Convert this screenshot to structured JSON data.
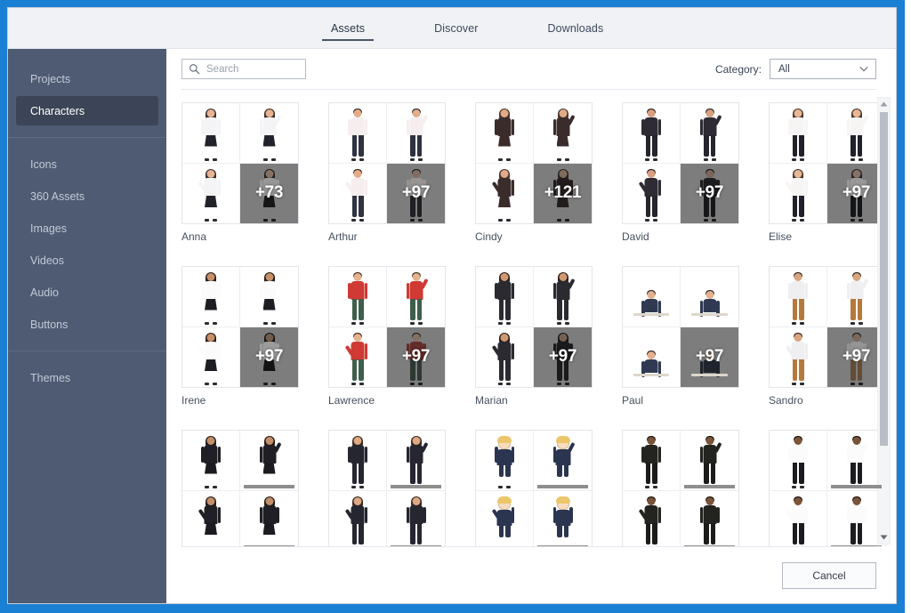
{
  "window": {
    "frame_color": "#1a80d4",
    "sidebar_color": "#4e5b73",
    "header_color": "#f0f2f5"
  },
  "tabs": [
    {
      "label": "Assets",
      "active": true
    },
    {
      "label": "Discover",
      "active": false
    },
    {
      "label": "Downloads",
      "active": false
    }
  ],
  "sidebar": {
    "groups": [
      {
        "items": [
          {
            "label": "Projects",
            "active": false
          },
          {
            "label": "Characters",
            "active": true
          }
        ]
      },
      {
        "items": [
          {
            "label": "Icons",
            "active": false
          },
          {
            "label": "360 Assets",
            "active": false
          },
          {
            "label": "Images",
            "active": false
          },
          {
            "label": "Videos",
            "active": false
          },
          {
            "label": "Audio",
            "active": false
          },
          {
            "label": "Buttons",
            "active": false
          }
        ]
      },
      {
        "items": [
          {
            "label": "Themes",
            "active": false
          }
        ]
      }
    ]
  },
  "toolbar": {
    "search": {
      "placeholder": "Search",
      "value": ""
    },
    "category": {
      "label": "Category:",
      "selected": "All",
      "options": [
        "All"
      ]
    }
  },
  "grid": {
    "cards": [
      {
        "name": "Anna",
        "more": "+73",
        "kind": "woman-skirt",
        "hair": "#3a2e28",
        "top": "#f4f4f6",
        "bottom": "#22232a",
        "skin": "#e6b493"
      },
      {
        "name": "Arthur",
        "more": "+97",
        "kind": "man-suit",
        "hair": "#2b2521",
        "top": "#f6eeee",
        "bottom": "#2f3340",
        "skin": "#e2ac89"
      },
      {
        "name": "Cindy",
        "more": "+121",
        "kind": "woman-dress",
        "hair": "#4a332a",
        "top": "#3b2c2c",
        "bottom": "#3b2c2c",
        "skin": "#e0ab88"
      },
      {
        "name": "David",
        "more": "+97",
        "kind": "man-dark",
        "hair": "#241f1c",
        "top": "#2e2b34",
        "bottom": "#26242c",
        "skin": "#d8a080"
      },
      {
        "name": "Elise",
        "more": "+97",
        "kind": "woman-pants",
        "hair": "#4b342a",
        "top": "#f7f4f4",
        "bottom": "#20212a",
        "skin": "#e7b795"
      },
      {
        "name": "Irene",
        "more": "+97",
        "kind": "woman-skirt",
        "hair": "#241b16",
        "top": "#fbfbfc",
        "bottom": "#1d1e24",
        "skin": "#c89068"
      },
      {
        "name": "Lawrence",
        "more": "+97",
        "kind": "worker",
        "hair": "#3a2b22",
        "top": "#cf3a34",
        "bottom": "#3f5f4c",
        "skin": "#e4b28d"
      },
      {
        "name": "Marian",
        "more": "+97",
        "kind": "woman-suit",
        "hair": "#2a1d17",
        "top": "#2a2a30",
        "bottom": "#2a2a30",
        "skin": "#cf9a72"
      },
      {
        "name": "Paul",
        "more": "+97",
        "kind": "seated",
        "hair": "#2a2420",
        "top": "#2f3a52",
        "bottom": "#2f3a52",
        "skin": "#e3b08e"
      },
      {
        "name": "Sandro",
        "more": "+97",
        "kind": "casual",
        "hair": "#2b211b",
        "top": "#efeef0",
        "bottom": "#b5793c",
        "skin": "#d8a57e"
      },
      {
        "name": "",
        "more": "",
        "kind": "woman-skirt",
        "hair": "#241b16",
        "top": "#1f1f25",
        "bottom": "#1b1b21",
        "skin": "#c18f6a",
        "partial": true
      },
      {
        "name": "",
        "more": "",
        "kind": "woman-suit",
        "hair": "#3a2820",
        "top": "#262630",
        "bottom": "#262630",
        "skin": "#dda883",
        "partial": true
      },
      {
        "name": "",
        "more": "",
        "kind": "cartoon",
        "hair": "#ecc66a",
        "top": "#2b3550",
        "bottom": "#2b3550",
        "skin": "#f7dcc0",
        "partial": true
      },
      {
        "name": "",
        "more": "",
        "kind": "man-suit",
        "hair": "#17130f",
        "top": "#23231f",
        "bottom": "#1c1c1a",
        "skin": "#7a5338",
        "partial": true
      },
      {
        "name": "",
        "more": "",
        "kind": "doctor",
        "hair": "#15110d",
        "top": "#fbfbfb",
        "bottom": "#1c1c20",
        "skin": "#7c5438",
        "partial": true
      }
    ]
  },
  "scrollbar": {
    "up_icon": "triangle-up",
    "down_icon": "triangle-down"
  },
  "footer": {
    "cancel_label": "Cancel"
  }
}
